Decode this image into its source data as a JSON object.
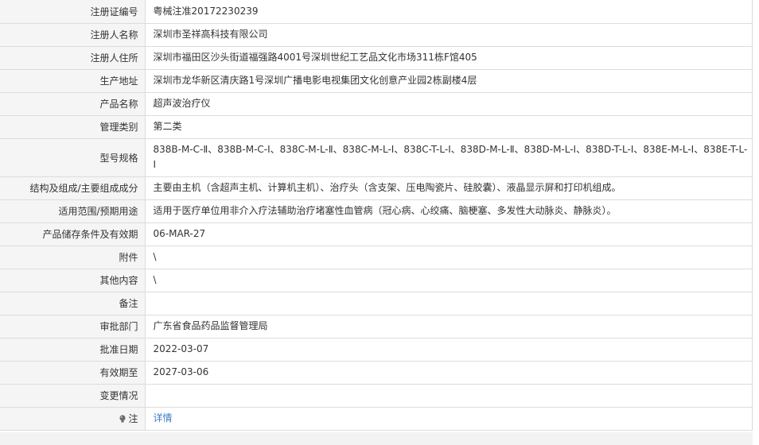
{
  "rows": [
    {
      "label": "注册证编号",
      "value": "粤械注准20172230239"
    },
    {
      "label": "注册人名称",
      "value": "深圳市圣祥高科技有限公司"
    },
    {
      "label": "注册人住所",
      "value": "深圳市福田区沙头街道福强路4001号深圳世纪工艺品文化市场311栋F馆405"
    },
    {
      "label": "生产地址",
      "value": "深圳市龙华新区清庆路1号深圳广播电影电视集团文化创意产业园2栋副楼4层"
    },
    {
      "label": "产品名称",
      "value": "超声波治疗仪"
    },
    {
      "label": "管理类别",
      "value": "第二类"
    },
    {
      "label": "型号规格",
      "value": "838B-M-C-Ⅱ、838B-M-C-Ⅰ、838C-M-L-Ⅱ、838C-M-L-Ⅰ、838C-T-L-Ⅰ、838D-M-L-Ⅱ、838D-M-L-Ⅰ、838D-T-L-Ⅰ、838E-M-L-Ⅰ、838E-T-L-Ⅰ"
    },
    {
      "label": "结构及组成/主要组成成分",
      "value": "主要由主机（含超声主机、计算机主机）、治疗头（含支架、压电陶瓷片、硅胶囊）、液晶显示屏和打印机组成。"
    },
    {
      "label": "适用范围/预期用途",
      "value": "适用于医疗单位用非介入疗法辅助治疗堵塞性血管病（冠心病、心绞痛、脑梗塞、多发性大动脉炎、静脉炎）。"
    },
    {
      "label": "产品储存条件及有效期",
      "value": "06-MAR-27"
    },
    {
      "label": "附件",
      "value": "\\"
    },
    {
      "label": "其他内容",
      "value": "\\"
    },
    {
      "label": "备注",
      "value": ""
    },
    {
      "label": "审批部门",
      "value": "广东省食品药品监督管理局"
    },
    {
      "label": "批准日期",
      "value": "2022-03-07"
    },
    {
      "label": "有效期至",
      "value": "2027-03-06"
    },
    {
      "label": "变更情况",
      "value": ""
    }
  ],
  "note": {
    "icon": "bulb-icon",
    "label": "注",
    "link_text": "详情"
  }
}
